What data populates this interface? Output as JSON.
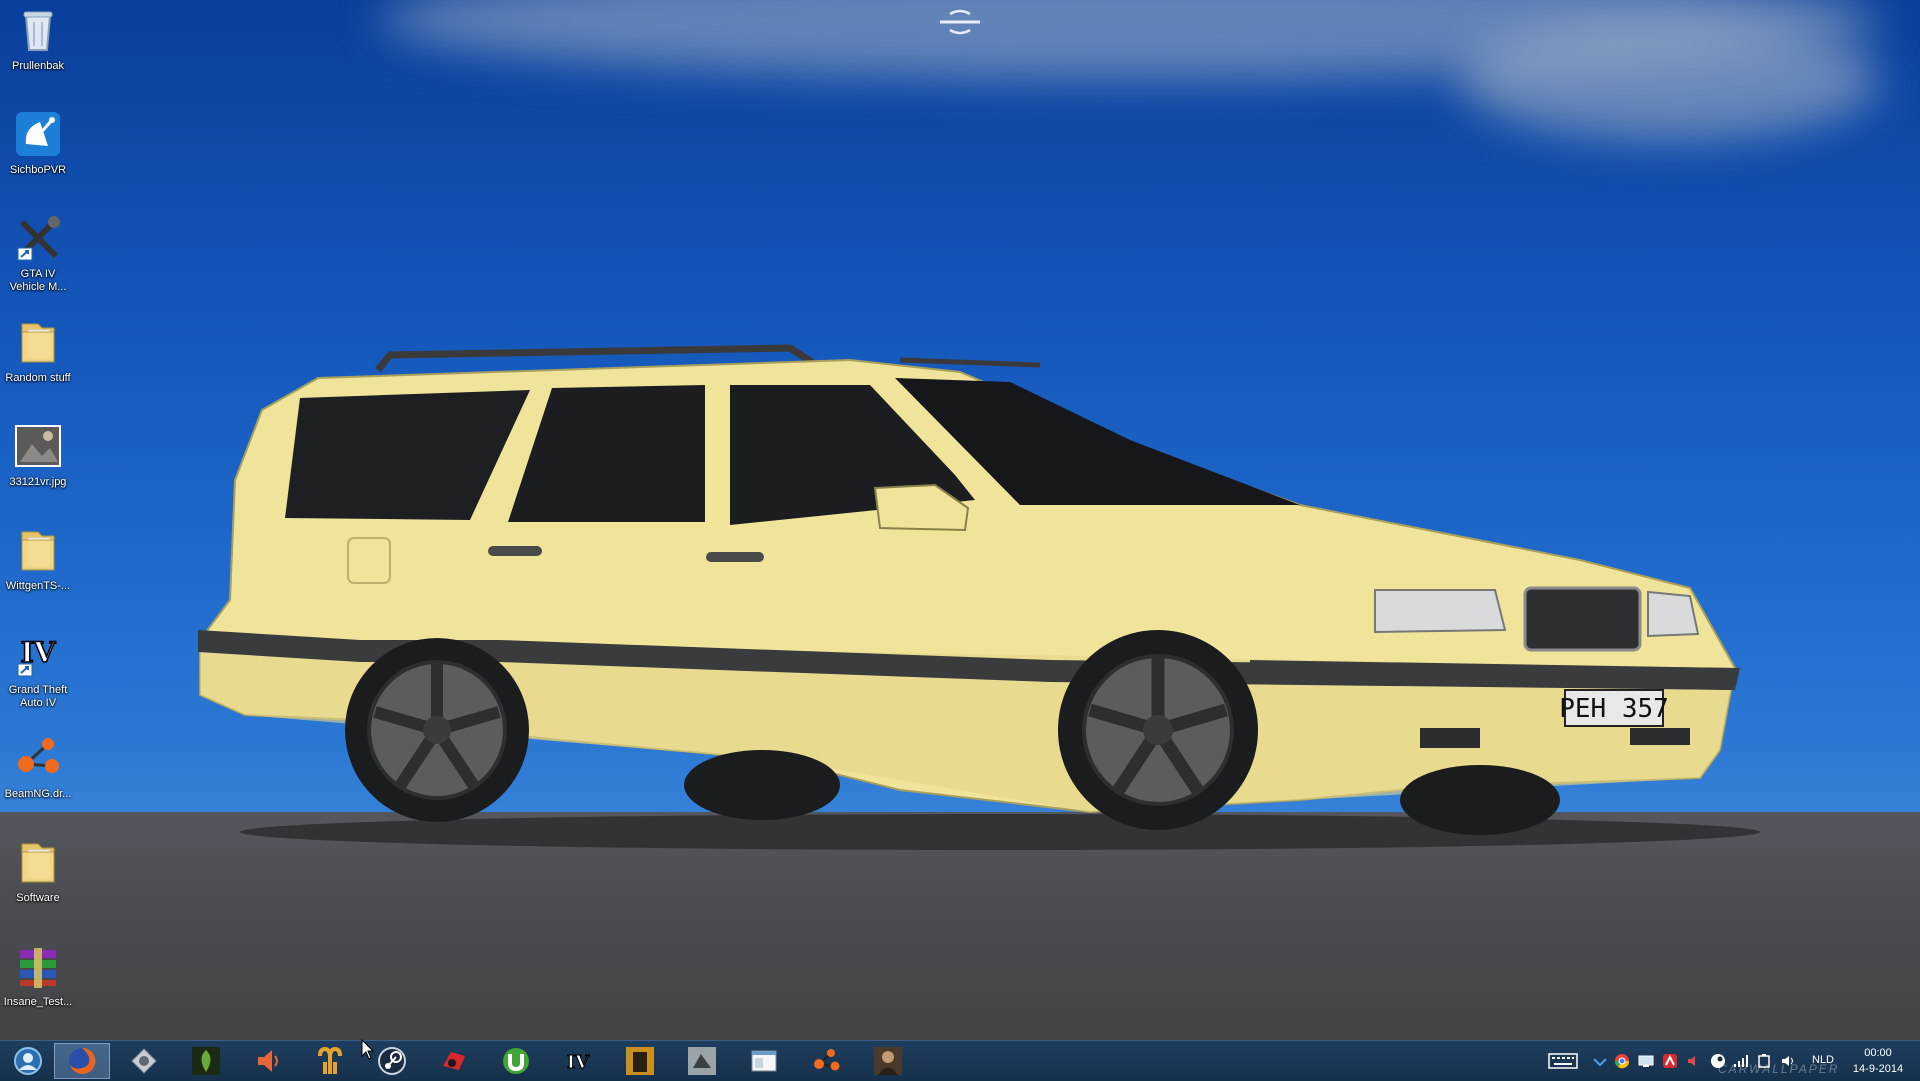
{
  "desktop": {
    "wallpaper_plate": "PEH 357",
    "icons": [
      {
        "label": "Prullenbak",
        "icon": "recycle-bin-icon"
      },
      {
        "label": "SichboPVR",
        "icon": "satellite-dish-icon"
      },
      {
        "label": "GTA IV\nVehicle M...",
        "icon": "tools-icon"
      },
      {
        "label": "Random stuff",
        "icon": "folder-icon"
      },
      {
        "label": "33121vr.jpg",
        "icon": "image-file-icon"
      },
      {
        "label": "WittgenTS-...",
        "icon": "folder-icon"
      },
      {
        "label": "Grand Theft\nAuto IV",
        "icon": "gta-iv-icon"
      },
      {
        "label": "BeamNG.dr...",
        "icon": "beamng-icon"
      },
      {
        "label": "Software",
        "icon": "folder-icon"
      },
      {
        "label": "Insane_Test...",
        "icon": "winrar-archive-icon"
      }
    ]
  },
  "taskbar": {
    "pinned": [
      "start-orb-icon",
      "firefox-icon",
      "settings-icon",
      "alien-game-icon",
      "speaker-app-icon",
      "aries-icon",
      "steam-icon",
      "red-app-icon",
      "utorrent-icon",
      "gta-iv-icon",
      "deus-ex-icon",
      "game-icon",
      "window-app-icon",
      "beamng-icon",
      "character-game-icon"
    ],
    "tray": {
      "language": "NLD",
      "time": "00:00",
      "date": "14-9-2014"
    }
  },
  "watermark": "CARWALLPAPER",
  "colors": {
    "sky": "#1456b9",
    "car": "#efe49a",
    "taskbar": "#15304b"
  }
}
